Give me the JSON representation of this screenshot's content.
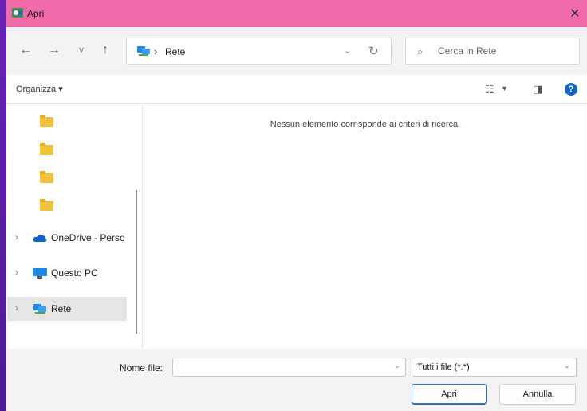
{
  "window": {
    "title": "Apri",
    "close_glyph": "✕"
  },
  "nav": {
    "back_glyph": "←",
    "forward_glyph": "→",
    "recent_glyph": "˅",
    "up_glyph": "↑",
    "address_separator": "›",
    "address_location": "Rete",
    "address_dropdown_glyph": "⌄",
    "refresh_glyph": "↻"
  },
  "search": {
    "placeholder": "Cerca in Rete",
    "icon": "search-icon"
  },
  "toolbar": {
    "organize_label": "Organizza ▾",
    "view_glyph": "☷",
    "view_dropdown_glyph": "▾",
    "preview_glyph": "◨",
    "help_glyph": "?"
  },
  "sidebar": {
    "items": [
      {
        "label": "OneDrive - Perso",
        "icon": "cloud-icon",
        "color": "#0a64c8"
      },
      {
        "label": "Questo PC",
        "icon": "computer-icon",
        "color": "#1e88e5"
      },
      {
        "label": "Rete",
        "icon": "network-icon",
        "color": "#1e88e5",
        "selected": true
      }
    ],
    "expand_glyph": "›"
  },
  "main": {
    "empty_message": "Nessun elemento corrisponde ai criteri di ricerca."
  },
  "footer": {
    "filename_label": "Nome file:",
    "filename_value": "",
    "filter_value": "Tutti i file (*.*)",
    "open_label": "Apri",
    "cancel_label": "Annulla"
  },
  "colors": {
    "titlebar": "#f06aa8",
    "desktop": "#5b1fa6",
    "accent": "#2a6fc9",
    "folder": "#f0c23b"
  }
}
